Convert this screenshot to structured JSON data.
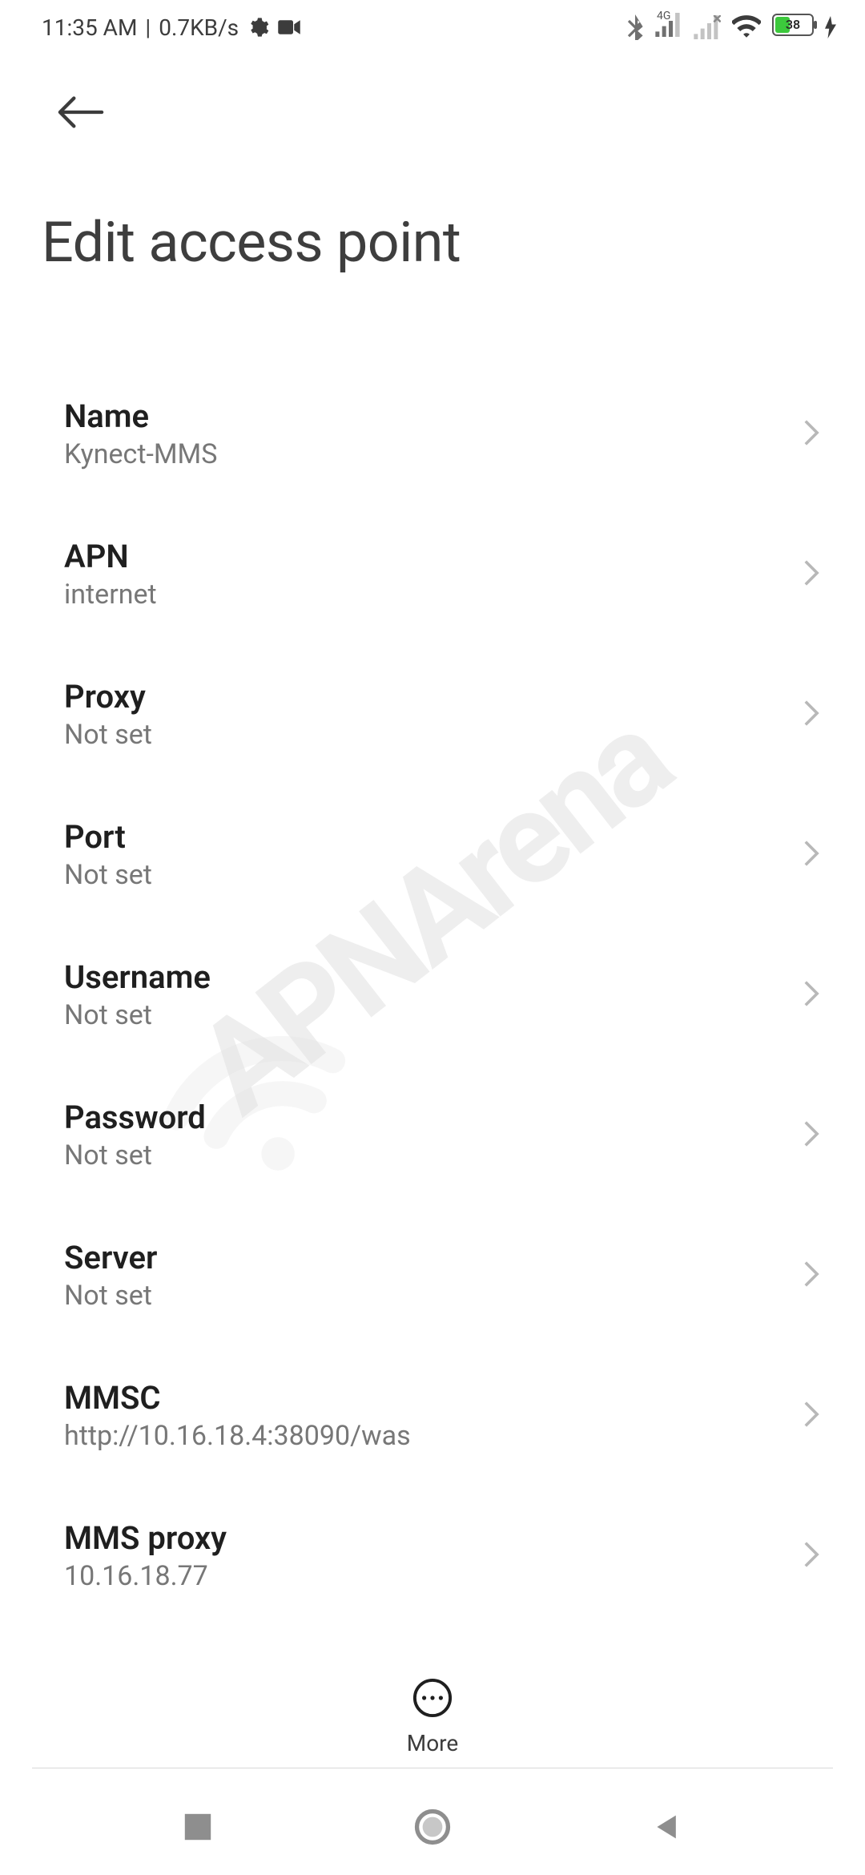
{
  "status": {
    "time": "11:35 AM",
    "sep": "|",
    "data_rate": "0.7KB/s",
    "network_type": "4G",
    "battery_pct": "38"
  },
  "header": {
    "title": "Edit access point"
  },
  "settings": [
    {
      "label": "Name",
      "value": "Kynect-MMS"
    },
    {
      "label": "APN",
      "value": "internet"
    },
    {
      "label": "Proxy",
      "value": "Not set"
    },
    {
      "label": "Port",
      "value": "Not set"
    },
    {
      "label": "Username",
      "value": "Not set"
    },
    {
      "label": "Password",
      "value": "Not set"
    },
    {
      "label": "Server",
      "value": "Not set"
    },
    {
      "label": "MMSC",
      "value": "http://10.16.18.4:38090/was"
    },
    {
      "label": "MMS proxy",
      "value": "10.16.18.77"
    }
  ],
  "actions": {
    "more_label": "More"
  },
  "watermark": "APNArena"
}
